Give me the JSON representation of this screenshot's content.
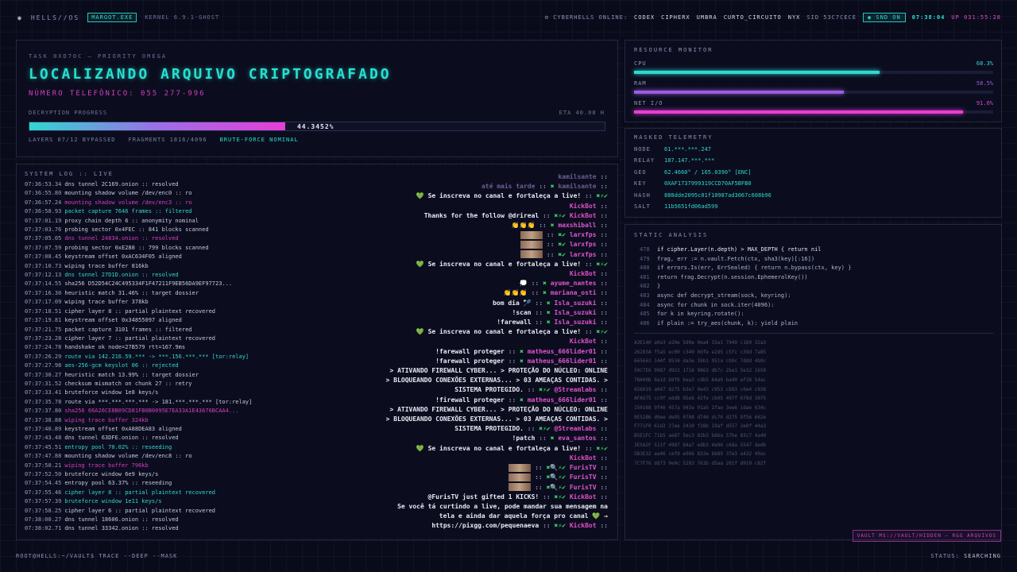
{
  "topbar": {
    "brand": "HELLS//OS",
    "badge": "MARGOT.EXE",
    "kernel": "KERNEL 6.9.1-GHOST",
    "online_label": "CYBERHELLS ONLINE:",
    "crew": [
      "CODEX",
      "CIPHERX",
      "UMBRA",
      "CURTO_CIRCUITO",
      "NYX"
    ],
    "sid": "SID 53C7CECE",
    "snd": "SND ON",
    "clock": "07:38:04",
    "uptime": "UP 031:55:28"
  },
  "task": {
    "label": "TASK 0XD70C — PRIORITY OMEGA",
    "title": "LOCALIZANDO ARQUIVO CRIPTOGRAFADO",
    "phone": "NÚMERO TELEFÔNICO: 055 277-996",
    "progress_label": "DECRYPTION PROGRESS",
    "eta": "ETA 40.08 H",
    "progress_percent": 44.3452,
    "progress_text": "44.3452%",
    "layers": "LAYERS 07/12 BYPASSED",
    "fragments": "FRAGMENTS 1816/4096",
    "bruteforce": "BRUTE-FORCE NOMINAL"
  },
  "syslog": {
    "label": "SYSTEM LOG :: LIVE",
    "lines": [
      {
        "t": "07:36:53.34",
        "m": "dns tunnel 2C169.onion :: resolved",
        "c": ""
      },
      {
        "t": "07:36:55.80",
        "m": "mounting shadow volume /dev/enc0 :: ro",
        "c": ""
      },
      {
        "t": "07:36:57.24",
        "m": "mounting shadow volume /dev/enc3 :: ro",
        "c": "mag"
      },
      {
        "t": "07:36:58.93",
        "m": "packet capture 7646 frames :: filtered",
        "c": "cyan"
      },
      {
        "t": "07:37:01.19",
        "m": "proxy chain depth 6 :: anonymity nominal",
        "c": ""
      },
      {
        "t": "07:37:03.76",
        "m": "probing sector 0x4FEC :: 841 blocks scanned",
        "c": ""
      },
      {
        "t": "07:37:05.05",
        "m": "dns tunnel 24834.onion :: resolved",
        "c": "mag"
      },
      {
        "t": "07:37:07.59",
        "m": "probing sector 0xE288 :: 799 blocks scanned",
        "c": ""
      },
      {
        "t": "07:37:08.45",
        "m": "keystream offset 0xAC634F05 aligned",
        "c": ""
      },
      {
        "t": "07:37:10.73",
        "m": "wiping trace buffer 816kb",
        "c": ""
      },
      {
        "t": "07:37:12.13",
        "m": "dns tunnel 27D1D.onion :: resolved",
        "c": "cyan"
      },
      {
        "t": "07:37:14.55",
        "m": "sha256 D52D54C24C495334F1F47211F9EB56DA9EF97723...",
        "c": ""
      },
      {
        "t": "07:37:16.30",
        "m": "heuristic match 31.46% :: target dossier",
        "c": ""
      },
      {
        "t": "07:37:17.09",
        "m": "wiping trace buffer 378kb",
        "c": ""
      },
      {
        "t": "07:37:18.51",
        "m": "cipher layer 8 :: partial plaintext recovered",
        "c": ""
      },
      {
        "t": "07:37:19.81",
        "m": "keystream offset 0x34855097 aligned",
        "c": ""
      },
      {
        "t": "07:37:21.75",
        "m": "packet capture 3101 frames :: filtered",
        "c": ""
      },
      {
        "t": "07:37:23.28",
        "m": "cipher layer 7 :: partial plaintext recovered",
        "c": ""
      },
      {
        "t": "07:37:24.78",
        "m": "handshake ok node=27B579 rtt=167.9ms",
        "c": ""
      },
      {
        "t": "07:37:26.29",
        "m": "route via 142.216.59.*** -> ***.156.***.*** [tor:relay]",
        "c": "cyan"
      },
      {
        "t": "07:37:27.98",
        "m": "aes-256-gcm keyslot 06 :: rejected",
        "c": "cyan"
      },
      {
        "t": "07:37:30.27",
        "m": "heuristic match 13.99% :: target dossier",
        "c": ""
      },
      {
        "t": "07:37:31.52",
        "m": "checksum mismatch on chunk 27 :: retry",
        "c": ""
      },
      {
        "t": "07:37:33.41",
        "m": "bruteforce window 1e8 keys/s",
        "c": ""
      },
      {
        "t": "07:37:35.78",
        "m": "route via ***.***.***.*** -> 181.***.***.*** [tor:relay]",
        "c": ""
      },
      {
        "t": "07:37:37.80",
        "m": "sha256 66A26CE8B09CD81FB0B0095E7EA33A1E43676BCAA4...",
        "c": "mag"
      },
      {
        "t": "07:37:38.88",
        "m": "wiping trace buffer 324kb",
        "c": "mag"
      },
      {
        "t": "07:37:40.89",
        "m": "keystream offset 0xA88DEA83 aligned",
        "c": ""
      },
      {
        "t": "07:37:43.48",
        "m": "dns tunnel 63DFE.onion :: resolved",
        "c": ""
      },
      {
        "t": "07:37:45.51",
        "m": "entropy pool 70.02% :: reseeding",
        "c": "cyan"
      },
      {
        "t": "07:37:47.88",
        "m": "mounting shadow volume /dev/enc8 :: ro",
        "c": ""
      },
      {
        "t": "07:37:50.21",
        "m": "wiping trace buffer 796kb",
        "c": "mag"
      },
      {
        "t": "07:37:52.50",
        "m": "bruteforce window 6e9 keys/s",
        "c": ""
      },
      {
        "t": "07:37:54.45",
        "m": "entropy pool 63.37% :: reseeding",
        "c": ""
      },
      {
        "t": "07:37:55.46",
        "m": "cipher layer 8 :: partial plaintext recovered",
        "c": "cyan"
      },
      {
        "t": "07:37:57.39",
        "m": "bruteforce window 1e11 keys/s",
        "c": "cyan"
      },
      {
        "t": "07:37:58.25",
        "m": "cipher layer 6 :: partial plaintext recovered",
        "c": ""
      },
      {
        "t": "07:38:00.27",
        "m": "dns tunnel 18606.onion :: resolved",
        "c": ""
      },
      {
        "t": "07:38:02.71",
        "m": "dns tunnel 33342.onion :: resolved",
        "c": ""
      }
    ]
  },
  "chat": [
    {
      "pre": "",
      "msg": "",
      "user": "kamilsante",
      "icons": "",
      "ghost": true
    },
    {
      "pre": "",
      "msg": "até mais tarde",
      "user": "kamilsante",
      "icons": "✖",
      "ghost": true
    },
    {
      "pre": "💚",
      "msg": "Se inscreva no canal e fortaleça a live!",
      "user": "",
      "icons": "✖⚡✔",
      "ghost": false
    },
    {
      "pre": "",
      "msg": "",
      "user": "KickBot",
      "icons": "",
      "ghost": false
    },
    {
      "pre": "",
      "msg": "Thanks for the follow @drireal",
      "user": "KickBot",
      "icons": "✖⚡✔",
      "ghost": false
    },
    {
      "pre": "",
      "msg": "👏👏👏",
      "user": "maxshiball",
      "icons": "✖",
      "ghost": false
    },
    {
      "pre": "",
      "msg": "[thumb]",
      "user": "larxfps",
      "icons": "✖✔",
      "ghost": false
    },
    {
      "pre": "",
      "msg": "[thumb]",
      "user": "larxfps",
      "icons": "✖✔",
      "ghost": false
    },
    {
      "pre": "",
      "msg": "[thumb]",
      "user": "larxfps",
      "icons": "✖✔",
      "ghost": false
    },
    {
      "pre": "💚",
      "msg": "Se inscreva no canal e fortaleça a live!",
      "user": "",
      "icons": "✖⚡✔",
      "ghost": false
    },
    {
      "pre": "",
      "msg": "",
      "user": "KickBot",
      "icons": "",
      "ghost": false
    },
    {
      "pre": "",
      "msg": "💭",
      "user": "ayume_nantes",
      "icons": "✖",
      "ghost": false
    },
    {
      "pre": "",
      "msg": "👏👏👏",
      "user": "mariana_osti",
      "icons": "✖",
      "ghost": false
    },
    {
      "pre": "",
      "msg": "bom dia 🏸",
      "user": "Isla_suzuki",
      "icons": "✖",
      "ghost": false
    },
    {
      "pre": "",
      "msg": "!scan",
      "user": "Isla_suzuki",
      "icons": "✖",
      "ghost": false
    },
    {
      "pre": "",
      "msg": "!farewall",
      "user": "Isla_suzuki",
      "icons": "✖",
      "ghost": false
    },
    {
      "pre": "💚",
      "msg": "Se inscreva no canal e fortaleça a live!",
      "user": "",
      "icons": "✖⚡✔",
      "ghost": false
    },
    {
      "pre": "",
      "msg": "",
      "user": "KickBot",
      "icons": "",
      "ghost": false
    },
    {
      "pre": "",
      "msg": "!farewall proteger",
      "user": "matheus_666lider01",
      "icons": "✖",
      "ghost": false
    },
    {
      "pre": "",
      "msg": "!farewall proteger",
      "user": "matheus_666lider01",
      "icons": "✖",
      "ghost": false
    },
    {
      "pre": "",
      "msg": "> ATIVANDO FIREWALL CYBER... > PROTEÇÃO DO NÚCLEO: ONLINE",
      "user": "",
      "icons": "",
      "ghost": false
    },
    {
      "pre": "",
      "msg": "> BLOQUEANDO CONEXÕES EXTERNAS... > 03 AMEAÇAS CONTIDAS. >",
      "user": "",
      "icons": "",
      "ghost": false
    },
    {
      "pre": "",
      "msg": "SISTEMA PROTEGIDO.",
      "user": "@Streamlabs",
      "icons": "✖⚡✔",
      "ghost": false
    },
    {
      "pre": "",
      "msg": "!firewall proteger",
      "user": "matheus_666lider01",
      "icons": "✖",
      "ghost": false
    },
    {
      "pre": "",
      "msg": "> ATIVANDO FIREWALL CYBER... > PROTEÇÃO DO NÚCLEO: ONLINE",
      "user": "",
      "icons": "",
      "ghost": false
    },
    {
      "pre": "",
      "msg": "> BLOQUEANDO CONEXÕES EXTERNAS... > 03 AMEAÇAS CONTIDAS. >",
      "user": "",
      "icons": "",
      "ghost": false
    },
    {
      "pre": "",
      "msg": "SISTEMA PROTEGIDO.",
      "user": "@Streamlabs",
      "icons": "✖⚡✔",
      "ghost": false
    },
    {
      "pre": "",
      "msg": "!patch",
      "user": "eva_santos",
      "icons": "✖",
      "ghost": false
    },
    {
      "pre": "💚",
      "msg": "Se inscreva no canal e fortaleça a live!",
      "user": "",
      "icons": "✖⚡✔",
      "ghost": false
    },
    {
      "pre": "",
      "msg": "",
      "user": "KickBot",
      "icons": "",
      "ghost": false
    },
    {
      "pre": "",
      "msg": "[thumb]",
      "user": "FurisTV",
      "icons": "✖🔍⚡✔",
      "ghost": false
    },
    {
      "pre": "",
      "msg": "[thumb]",
      "user": "FurisTV",
      "icons": "✖🔍⚡✔",
      "ghost": false
    },
    {
      "pre": "",
      "msg": "[thumb]",
      "user": "FurisTV",
      "icons": "✖🔍⚡✔",
      "ghost": false
    },
    {
      "pre": "",
      "msg": "@FurisTV just gifted 1 KICKS!",
      "user": "KickBot",
      "icons": "✖⚡✔",
      "ghost": false
    },
    {
      "pre": "",
      "msg": "Se você tá curtindo a live, pode mandar sua mensagem na",
      "user": "",
      "icons": "",
      "ghost": false
    },
    {
      "pre": "",
      "msg": "tela e ainda dar aquela força pro canal 💚 →",
      "user": "",
      "icons": "",
      "ghost": false
    },
    {
      "pre": "",
      "msg": "https://pixgg.com/pequenaeva",
      "user": "KickBot",
      "icons": "✖⚡✔",
      "ghost": false
    }
  ],
  "resmon": {
    "label": "RESOURCE MONITOR",
    "items": [
      {
        "name": "CPU",
        "value": "68.3%",
        "fraction": 0.683,
        "color": "#2fd8d0"
      },
      {
        "name": "RAM",
        "value": "58.5%",
        "fraction": 0.585,
        "color": "#9c5ce0"
      },
      {
        "name": "NET I/O",
        "value": "91.6%",
        "fraction": 0.916,
        "color": "#e53fd6"
      }
    ]
  },
  "telemetry": {
    "label": "MASKED TELEMETRY",
    "rows": [
      {
        "k": "NODE",
        "v": "61.***.***.247"
      },
      {
        "k": "RELAY",
        "v": "187.147.***.***"
      },
      {
        "k": "GEO",
        "v": "62.4660° / 165.0390° [ENC]"
      },
      {
        "k": "KEY",
        "v": "0XAF1737999319CCD70AF5BFB0"
      },
      {
        "k": "HASH",
        "v": "888dde2095c01f10987ad3067c608b96"
      },
      {
        "k": "SALT",
        "v": "11b5651fd06ad599"
      }
    ]
  },
  "static": {
    "label": "STATIC ANALYSIS",
    "code": [
      {
        "n": "478",
        "c": "if cipher.Layer(n.depth) > MAX_DEPTH { return nil",
        "hl": true
      },
      {
        "n": "479",
        "c": "frag, err := n.vault.Fetch(ctx, sha3(key)[:16])",
        "hl": false
      },
      {
        "n": "480",
        "c": "if errors.Is(err, ErrSealed) { return n.bypass(ctx, key) }",
        "hl": false
      },
      {
        "n": "481",
        "c": "return frag.Decrypt(n.session.EphemeralKey())",
        "hl": false
      },
      {
        "n": "482",
        "c": "}",
        "hl": false
      },
      {
        "n": "483",
        "c": "async def decrypt_stream(sock, keyring):",
        "hl": false
      },
      {
        "n": "484",
        "c": "async for chunk in sock.iter(4096):",
        "hl": false
      },
      {
        "n": "485",
        "c": "for k in keyring.rotate():",
        "hl": false
      },
      {
        "n": "486",
        "c": "if plain := try_aes(chunk, k): yield plain",
        "hl": false
      }
    ],
    "hex": [
      "A3E140 a0e3 e20e 5d0e 0ea4 33a1 7949 c169 32a3",
      "26283A f5a5 ec00 c340 0dfe e2d5 c5fc c39d 7a85",
      "665663 144f 8534 da3e 1bb1 951a cb9c 7ddd 4b9c",
      "50C7E6 9987 d923 1716 9863 db7c 2ba1 5e32 1650",
      "7BA00D 0a1d b9f6 bea3 cdb5 64a0 ba40 af38 54ac",
      "656019 a047 8275 b3e7 0e43 c953 cb93 c0e4 c938",
      "AFA575 cc9f edd8 05eb 42fe cb05 497f 678d 3075",
      "150168 9f46 457a 943a 91a5 1fae 3ee6 1dae 634c",
      "8E5286 d0ee de95 0708 d740 dc70 d275 8f56 662e",
      "F771F0 61d2 27ee 2430 f38b 19af d557 2e0f 44a3",
      "B5E1FC 71b5 ae87 5ec3 82b3 b86a 57be 83c7 4a40",
      "3E5A2F 511f 4987 84a7 edb3 4e96 c6da 5547 dedb",
      "5B3E32 aa46 cefd e966 833a b689 37e3 a432 49ac",
      "7C7F76 dd73 0e0c 5293 763b d5aa 201f d919 c82f"
    ]
  },
  "bottom": {
    "vault": "VAULT MS://VAULT/HIDDEN — R&G ARQUIVOS",
    "prompt": "ROOT@HELLS:~/VAULT$ TRACE --DEEP --MASK",
    "status_label": "STATUS:",
    "status_value": "SEARCHING"
  }
}
